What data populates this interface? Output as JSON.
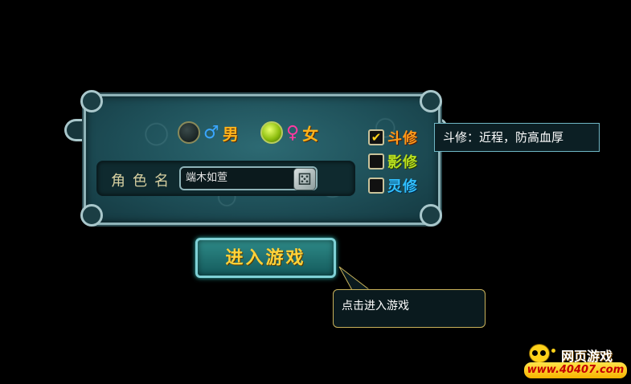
{
  "gender": {
    "male_label": "男",
    "female_label": "女",
    "male_symbol": "♂",
    "female_symbol": "♀",
    "selected": "female"
  },
  "name": {
    "label": "角色名",
    "value": "端木如萱"
  },
  "classes": [
    {
      "label": "斗修",
      "checked": true,
      "color": "#ff9a1a"
    },
    {
      "label": "影修",
      "checked": false,
      "color": "#b8e020"
    },
    {
      "label": "灵修",
      "checked": false,
      "color": "#30c0ff"
    }
  ],
  "class_tooltip": "斗修：近程，防高血厚",
  "enter_button": "进入游戏",
  "enter_tooltip": "点击进入游戏",
  "logo": {
    "title": "网页游戏",
    "url": "www.40407.com"
  }
}
